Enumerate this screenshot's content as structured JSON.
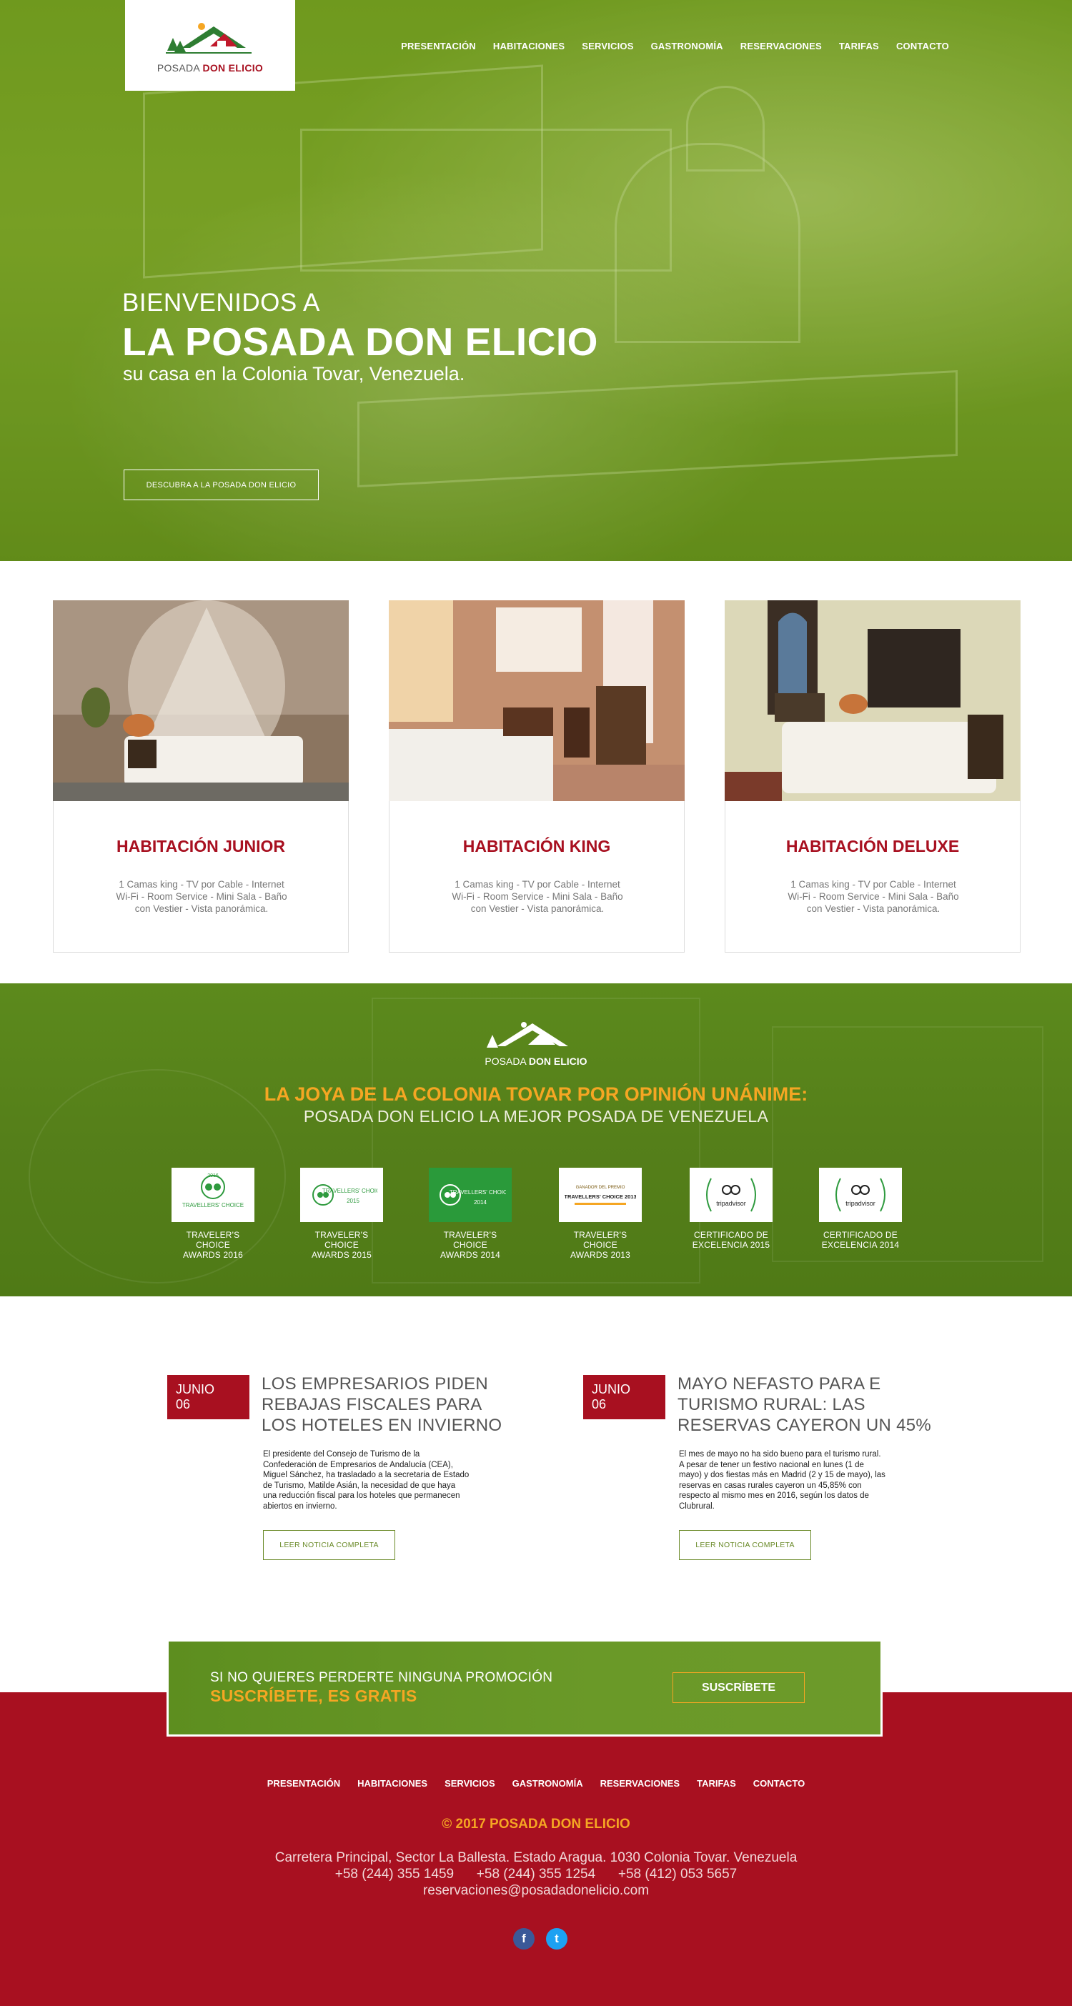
{
  "nav": [
    "PRESENTACIÓN",
    "HABITACIONES",
    "SERVICIOS",
    "GASTRONOMÍA",
    "RESERVACIONES",
    "TARIFAS",
    "CONTACTO"
  ],
  "logo": {
    "part1": "POSADA",
    "part2": "DON ELICIO"
  },
  "hero": {
    "pre": "BIENVENIDOS A",
    "title": "LA POSADA DON ELICIO",
    "subtitle": "su casa en la Colonia Tovar, Venezuela.",
    "button": "DESCUBRA A LA POSADA DON ELICIO"
  },
  "rooms": [
    {
      "title": "HABITACIÓN JUNIOR",
      "desc": "1 Camas king - TV por Cable - Internet Wi-Fi - Room Service - Mini Sala - Baño con Vestier - Vista panorámica."
    },
    {
      "title": "HABITACIÓN KING",
      "desc": "1 Camas king - TV por Cable - Internet Wi-Fi - Room Service - Mini Sala - Baño con Vestier - Vista panorámica."
    },
    {
      "title": "HABITACIÓN DELUXE",
      "desc": "1 Camas king - TV por Cable - Internet Wi-Fi - Room Service - Mini Sala - Baño con Vestier - Vista panorámica."
    }
  ],
  "awards_section": {
    "heading": "LA JOYA DE LA COLONIA TOVAR POR OPINIÓN UNÁNIME:",
    "subheading": "POSADA DON ELICIO LA MEJOR POSADA DE VENEZUELA",
    "awards": [
      {
        "line1": "TRAVELER'S CHOICE",
        "line2": "AWARDS 2016",
        "badge": "TRAVELLERS' CHOICE",
        "year": "2016"
      },
      {
        "line1": "TRAVELER'S CHOICE",
        "line2": "AWARDS 2015",
        "badge": "TRAVELLERS' CHOICE",
        "year": "2015"
      },
      {
        "line1": "TRAVELER'S CHOICE",
        "line2": "AWARDS 2014",
        "badge": "TRAVELLERS' CHOICE",
        "year": "2014"
      },
      {
        "line1": "TRAVELER'S CHOICE",
        "line2": "AWARDS 2013",
        "badge": "TRAVELLERS' CHOICE 2013",
        "year": "GANADOR DEL PREMIO"
      },
      {
        "line1": "CERTIFICADO DE",
        "line2": "EXCELENCIA 2015",
        "badge": "tripadvisor",
        "year": ""
      },
      {
        "line1": "CERTIFICADO DE",
        "line2": "EXCELENCIA 2014",
        "badge": "tripadvisor",
        "year": ""
      }
    ]
  },
  "news": [
    {
      "month": "JUNIO",
      "day": "06",
      "title": "LOS EMPRESARIOS PIDEN REBAJAS FISCALES PARA LOS HOTELES EN INVIERNO",
      "body": "El presidente del Consejo de Turismo de la Confederación de Empresarios de Andalucía (CEA), Miguel Sánchez, ha trasladado a la secretaria de Estado de Turismo, Matilde Asián, la necesidad de que haya una reducción fiscal para los hoteles que permanecen abiertos en invierno.",
      "button": "LEER NOTICIA COMPLETA"
    },
    {
      "month": "JUNIO",
      "day": "06",
      "title": "MAYO NEFASTO PARA E TURISMO RURAL: LAS RESERVAS CAYERON UN 45%",
      "body": "El mes de mayo no ha sido bueno para el turismo rural. A pesar de tener un festivo nacional en lunes (1 de mayo) y dos fiestas más en Madrid (2 y 15 de mayo), las reservas en casas rurales cayeron un 45,85% con respecto al mismo mes en 2016, según los datos de Clubrural.",
      "button": "LEER NOTICIA COMPLETA"
    }
  ],
  "promo": {
    "line1": "SI NO QUIERES PERDERTE NINGUNA PROMOCIÓN",
    "line2": "SUSCRÍBETE, ES GRATIS",
    "button": "SUSCRÍBETE"
  },
  "footer": {
    "copyright": "© 2017 POSADA DON ELICIO",
    "address": "Carretera Principal, Sector La Ballesta. Estado Aragua. 1030 Colonia Tovar. Venezuela",
    "phones": "+58 (244) 355 1459      +58 (244) 355 1254      +58 (412) 053 5657",
    "email": "reservaciones@posadadonelicio.com",
    "social": [
      "f",
      "t"
    ]
  },
  "colors": {
    "brand_red": "#a81020",
    "brand_green": "#6a9928",
    "accent_orange": "#f5a623"
  }
}
